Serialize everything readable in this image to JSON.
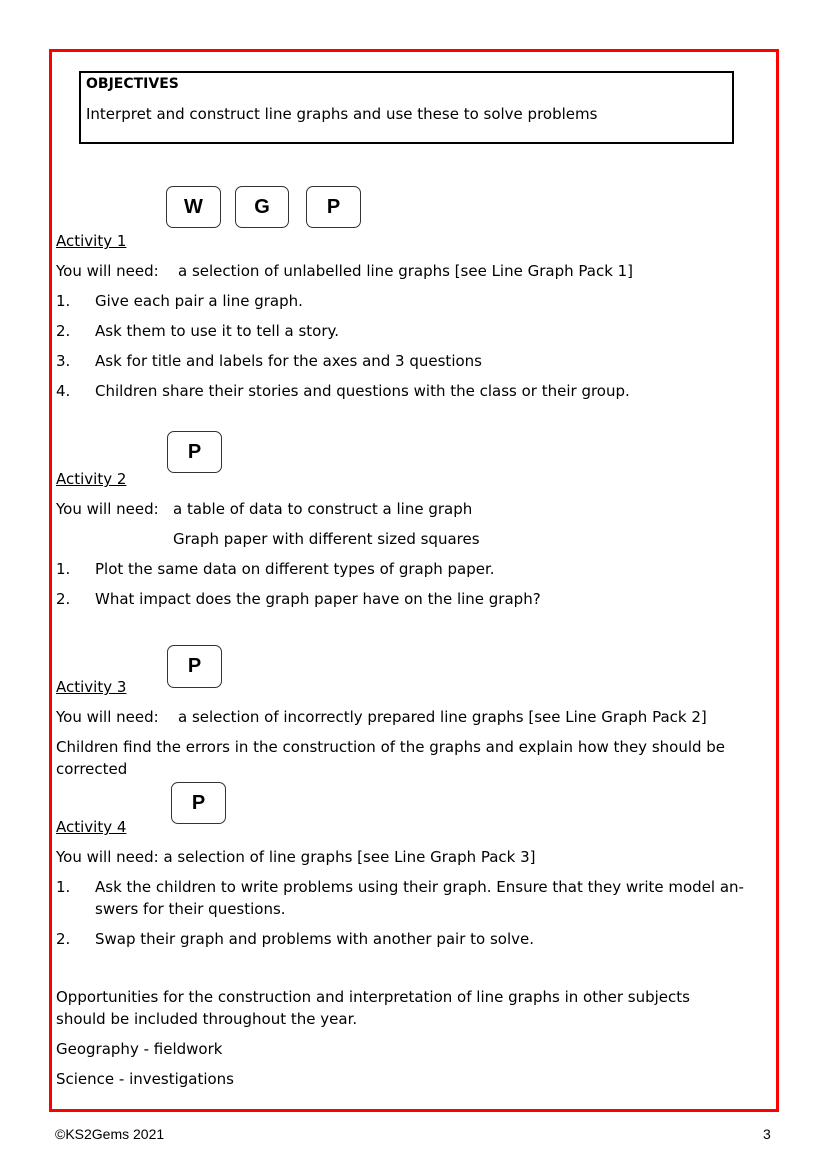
{
  "objectives": {
    "heading": "OBJECTIVES",
    "text": "Interpret and construct line graphs and use these to solve problems"
  },
  "grouping_badges": [
    "W",
    "G",
    "P"
  ],
  "activities": [
    {
      "title": "Activity 1",
      "badges": [
        "P"
      ],
      "need_label": "You will need:",
      "need_items": [
        "a selection of unlabelled line graphs [see Line Graph Pack 1]"
      ],
      "steps": [
        {
          "n": "1.",
          "text": "Give each pair a line graph."
        },
        {
          "n": "2.",
          "text": "Ask them to use it to tell a story."
        },
        {
          "n": "3.",
          "text": "Ask for  title and labels for the axes and 3 questions"
        },
        {
          "n": "4.",
          "text": "Children share their stories and questions with the class or their group."
        }
      ]
    },
    {
      "title": "Activity 2",
      "badge": "P",
      "need_label": "You will need:",
      "need_items": [
        "a table of data to construct a line graph",
        "Graph paper with different sized squares"
      ],
      "steps": [
        {
          "n": "1.",
          "text": "Plot the same data on different types of graph paper."
        },
        {
          "n": "2.",
          "text": "What impact does the graph paper have on the line graph?"
        }
      ]
    },
    {
      "title": "Activity 3",
      "badge": "P",
      "need_label": "You will need:",
      "need_items": [
        "a selection of incorrectly prepared line graphs [see Line Graph Pack 2]"
      ],
      "text_line1": "Children find the errors in the construction  of the graphs and explain how they should be",
      "text_line2": "corrected"
    },
    {
      "title": "Activity 4",
      "badge": "P",
      "need_text": "You will need: a selection of line graphs [see Line Graph Pack 3]",
      "steps": [
        {
          "n": "1.",
          "line1": "Ask the children to write problems using their graph. Ensure that they write model an-",
          "line2": "swers for their questions."
        },
        {
          "n": "2.",
          "line1": "Swap their graph and problems with another pair to solve."
        }
      ]
    }
  ],
  "notes": {
    "line1": "Opportunities for the construction and interpretation of line graphs in other subjects",
    "line2": "should be included throughout the year.",
    "subjects": [
      "Geography - fieldwork",
      "Science - investigations"
    ]
  },
  "footer": {
    "copyright": "©KS2Gems 2021",
    "page_number": "3"
  },
  "colors": {
    "frame": "#ff0000",
    "text": "#000000"
  }
}
